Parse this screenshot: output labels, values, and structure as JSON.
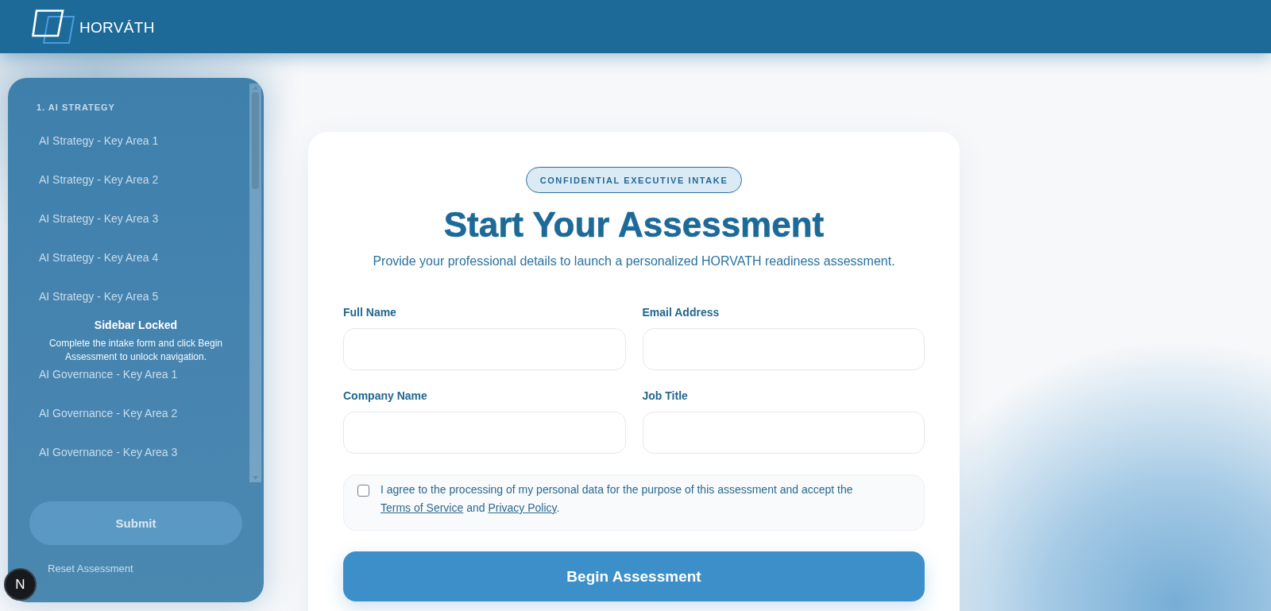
{
  "header": {
    "brand": "HORVÁTH"
  },
  "sidebar": {
    "locked": true,
    "sections": [
      {
        "title": "1. AI STRATEGY",
        "items": [
          "AI Strategy - Key Area 1",
          "AI Strategy - Key Area 2",
          "AI Strategy - Key Area 3",
          "AI Strategy - Key Area 4",
          "AI Strategy - Key Area 5"
        ]
      },
      {
        "items": [
          "AI Governance - Key Area 1",
          "AI Governance - Key Area 2",
          "AI Governance - Key Area 3"
        ]
      }
    ],
    "submit_label": "Submit",
    "footer_link": "Reset Assessment",
    "lock_title": "Sidebar Locked",
    "lock_message": "Complete the intake form and click Begin Assessment to unlock navigation."
  },
  "intake": {
    "badge": "CONFIDENTIAL EXECUTIVE INTAKE",
    "title": "Start Your Assessment",
    "subtitle": "Provide your professional details to launch a personalized HORVATH readiness assessment.",
    "fields": [
      {
        "label": "Full Name"
      },
      {
        "label": "Email Address"
      },
      {
        "label": "Company Name"
      },
      {
        "label": "Job Title"
      }
    ],
    "consent": {
      "checked": false,
      "parts": [
        {
          "kind": "text",
          "text": "I agree to the processing of my personal data for the purpose of this assessment and accept the "
        },
        {
          "kind": "link",
          "text": "Terms of Service"
        },
        {
          "kind": "text",
          "text": " and "
        },
        {
          "kind": "link",
          "text": "Privacy Policy"
        },
        {
          "kind": "text",
          "text": "."
        }
      ]
    },
    "submit_label": "Begin Assessment"
  },
  "dev_tools": {
    "label": "N"
  }
}
